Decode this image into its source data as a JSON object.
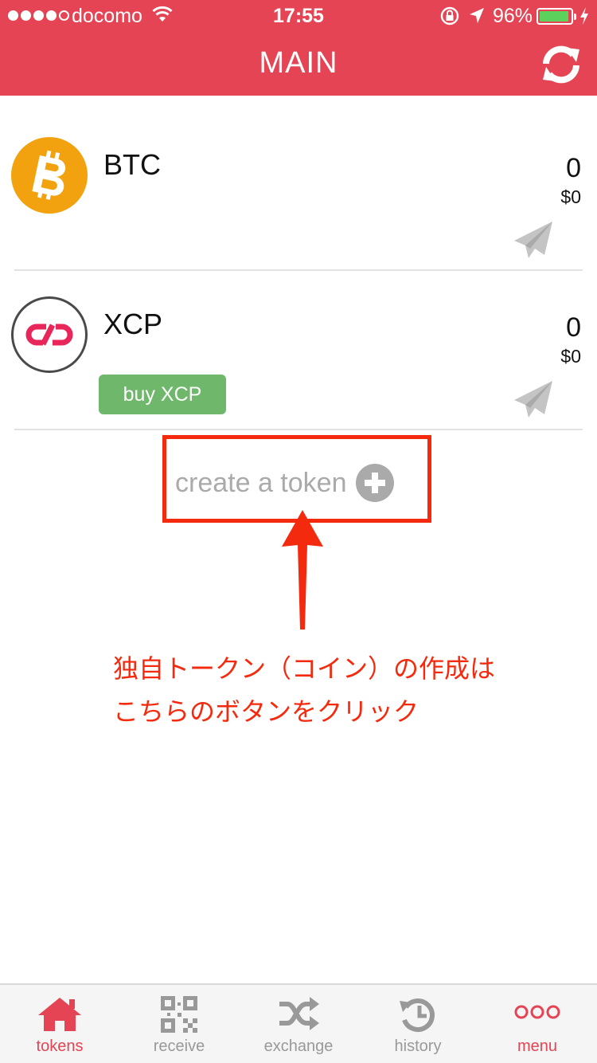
{
  "status_bar": {
    "carrier": "docomo",
    "time": "17:55",
    "battery_percent": "96%",
    "battery_level": 0.96,
    "signal_bars_filled": 4
  },
  "header": {
    "title": "MAIN",
    "refresh_icon": "refresh-icon"
  },
  "tokens": [
    {
      "name": "BTC",
      "amount": "0",
      "usd": "$0",
      "icon": "bitcoin-icon"
    },
    {
      "name": "XCP",
      "amount": "0",
      "usd": "$0",
      "icon": "counterparty-icon",
      "buy_label": "buy XCP"
    }
  ],
  "create_token": {
    "label": "create a token",
    "icon": "plus-circle-icon"
  },
  "annotation": {
    "line1": "独自トークン（コイン）の作成は",
    "line2": "こちらのボタンをクリック"
  },
  "tabbar": {
    "items": [
      {
        "label": "tokens",
        "icon": "home-icon",
        "active": true
      },
      {
        "label": "receive",
        "icon": "qr-code-icon"
      },
      {
        "label": "exchange",
        "icon": "shuffle-icon"
      },
      {
        "label": "history",
        "icon": "history-icon"
      },
      {
        "label": "menu",
        "icon": "more-icon"
      }
    ]
  },
  "colors": {
    "brand": "#e44454",
    "btc": "#f2a20f",
    "buy_button": "#6eb76b",
    "annotation": "#f42a0e",
    "muted": "#aaaaaa"
  }
}
